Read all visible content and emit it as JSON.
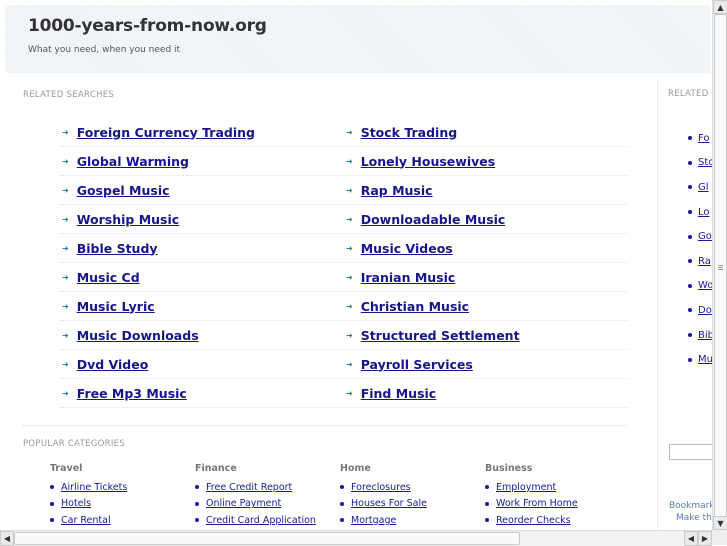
{
  "header": {
    "title": "1000-years-from-now.org",
    "tagline": "What you need, when you need it"
  },
  "related": {
    "label": "RELATED SEARCHES",
    "rows": [
      [
        "Foreign Currency Trading",
        "Stock Trading"
      ],
      [
        "Global Warming",
        "Lonely Housewives"
      ],
      [
        "Gospel Music",
        "Rap Music"
      ],
      [
        "Worship Music",
        "Downloadable Music"
      ],
      [
        "Bible Study",
        "Music Videos"
      ],
      [
        "Music Cd",
        "Iranian Music"
      ],
      [
        "Music Lyric",
        "Christian Music"
      ],
      [
        "Music Downloads",
        "Structured Settlement"
      ],
      [
        "Dvd Video",
        "Payroll Services"
      ],
      [
        "Free Mp3 Music",
        "Find Music"
      ]
    ]
  },
  "popular": {
    "label": "POPULAR CATEGORIES",
    "columns": [
      {
        "title": "Travel",
        "items": [
          "Airline Tickets",
          "Hotels",
          "Car Rental"
        ]
      },
      {
        "title": "Finance",
        "items": [
          "Free Credit Report",
          "Online Payment",
          "Credit Card Application"
        ]
      },
      {
        "title": "Home",
        "items": [
          "Foreclosures",
          "Houses For Sale",
          "Mortgage"
        ]
      },
      {
        "title": "Business",
        "items": [
          "Employment",
          "Work From Home",
          "Reorder Checks"
        ]
      }
    ]
  },
  "sidebar": {
    "label": "RELATED",
    "items": [
      "Fo",
      "Sto",
      "Gl",
      "Lo",
      "Go",
      "Ra",
      "Wo",
      "Do",
      "Bib",
      "Mu"
    ],
    "bookmark_line1": "Bookmark",
    "bookmark_line2": "Make thi"
  }
}
